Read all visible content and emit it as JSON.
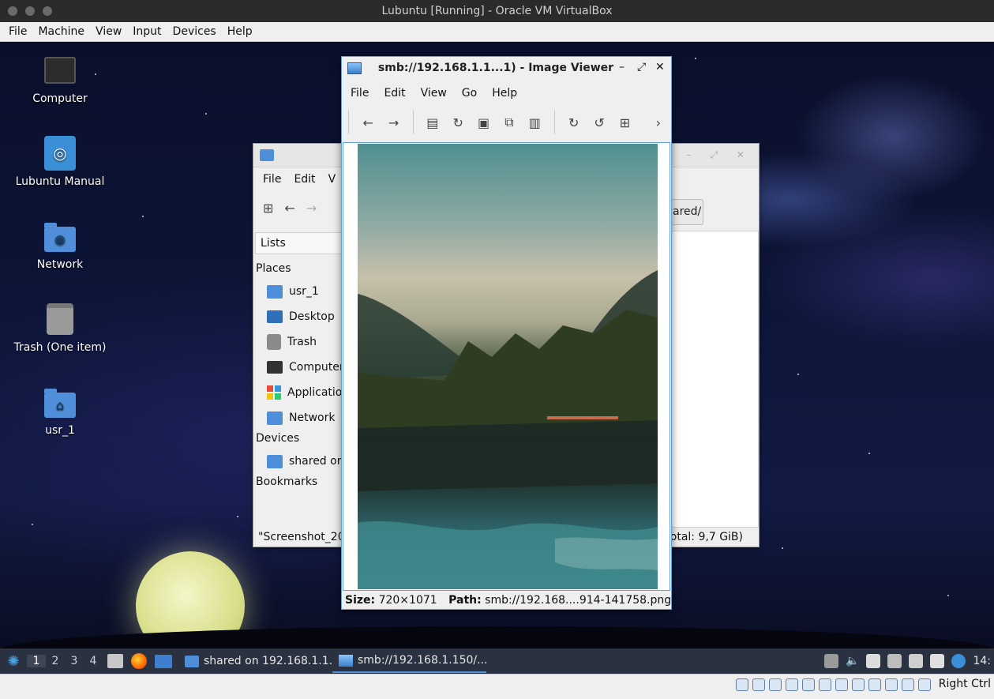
{
  "host": {
    "title": "Lubuntu [Running] - Oracle VM VirtualBox",
    "menu": [
      "File",
      "Machine",
      "View",
      "Input",
      "Devices",
      "Help"
    ],
    "right_ctrl": "Right Ctrl"
  },
  "desktop": {
    "icons": [
      {
        "label": "Computer",
        "icon": "computer-icon"
      },
      {
        "label": "Lubuntu Manual",
        "icon": "manual-icon"
      },
      {
        "label": "Network",
        "icon": "network-folder-icon"
      },
      {
        "label": "Trash (One item)",
        "icon": "trash-icon"
      },
      {
        "label": "usr_1",
        "icon": "home-folder-icon"
      }
    ]
  },
  "file_manager": {
    "menu": [
      "File",
      "Edit",
      "V"
    ],
    "path_fragment": "ared/",
    "lists_label": "Lists",
    "places_heading": "Places",
    "places": [
      {
        "label": "usr_1",
        "icon": "home-folder-icon"
      },
      {
        "label": "Desktop",
        "icon": "desktop-icon"
      },
      {
        "label": "Trash",
        "icon": "trash-icon"
      },
      {
        "label": "Computer",
        "icon": "computer-icon"
      },
      {
        "label": "Applicatio",
        "icon": "applications-icon"
      },
      {
        "label": "Network",
        "icon": "network-folder-icon"
      }
    ],
    "devices_heading": "Devices",
    "devices": [
      {
        "label": "shared on",
        "icon": "network-share-icon"
      }
    ],
    "bookmarks_heading": "Bookmarks",
    "status_left": "\"Screenshot_20",
    "status_right": "Total: 9,7 GiB)"
  },
  "image_viewer": {
    "title": "smb://192.168.1.1...1) - Image Viewer",
    "menu": [
      "File",
      "Edit",
      "View",
      "Go",
      "Help"
    ],
    "size_label": "Size:",
    "size_value": "720×1071",
    "path_label": "Path:",
    "path_value": "smb://192.168....914-141758.png"
  },
  "taskbar": {
    "workspaces": [
      "1",
      "2",
      "3",
      "4"
    ],
    "tasks": [
      {
        "label": "shared on 192.168.1.1...",
        "icon": "folder-icon"
      },
      {
        "label": "smb://192.168.1.150/...",
        "icon": "image-viewer-icon"
      }
    ],
    "clock_fragment": "14:"
  }
}
